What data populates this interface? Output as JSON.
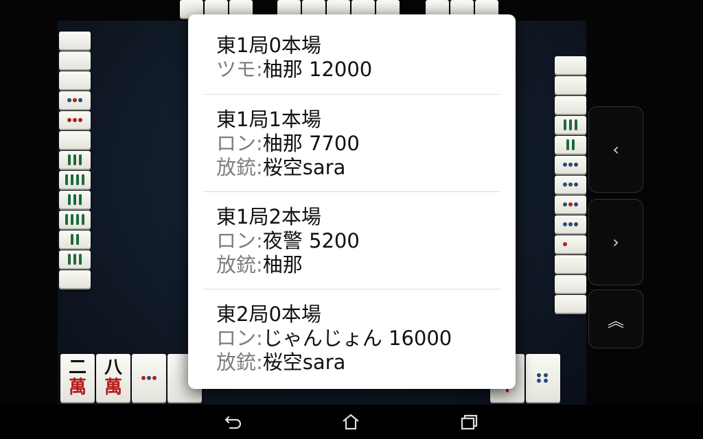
{
  "system_bar": {
    "back_icon": "back-arrow-icon",
    "home_icon": "home-icon",
    "recents_icon": "recents-icon"
  },
  "side_nav": {
    "prev_label": "‹",
    "next_label": "›",
    "up_label": "︽"
  },
  "board": {
    "hand_tiles": [
      {
        "top": "二",
        "bottom": "萬"
      },
      {
        "top": "八",
        "bottom": "萬"
      }
    ]
  },
  "results": [
    {
      "title": "東1局0本場",
      "win_label": "ツモ:",
      "win_value": "柚那 12000"
    },
    {
      "title": "東1局1本場",
      "win_label": "ロン:",
      "win_value": "柚那 7700",
      "deal_label": "放銃:",
      "deal_value": "桜空sara"
    },
    {
      "title": "東1局2本場",
      "win_label": "ロン:",
      "win_value": "夜警 5200",
      "deal_label": "放銃:",
      "deal_value": "柚那"
    },
    {
      "title": "東2局0本場",
      "win_label": "ロン:",
      "win_value": "じゃんじょん 16000",
      "deal_label": "放銃:",
      "deal_value": "桜空sara"
    }
  ]
}
